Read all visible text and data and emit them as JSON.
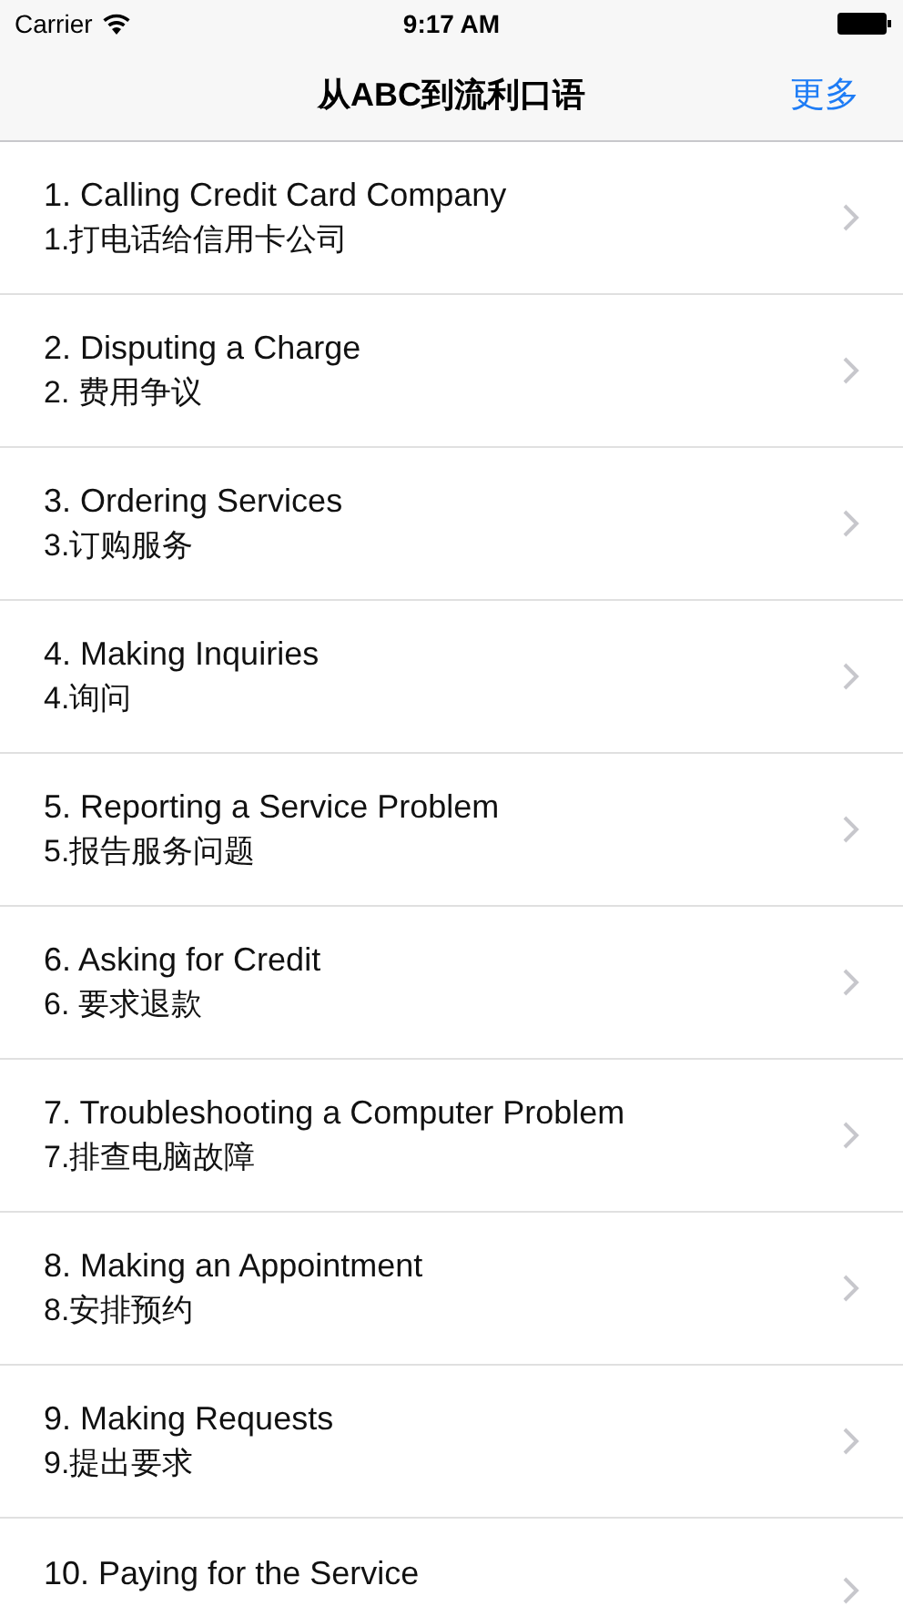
{
  "status_bar": {
    "carrier": "Carrier",
    "time": "9:17 AM"
  },
  "nav": {
    "title": "从ABC到流利口语",
    "action": "更多"
  },
  "items": [
    {
      "title": "1. Calling Credit Card Company",
      "subtitle": "1.打电话给信用卡公司"
    },
    {
      "title": "2. Disputing a Charge",
      "subtitle": "2. 费用争议"
    },
    {
      "title": "3. Ordering Services",
      "subtitle": "3.订购服务"
    },
    {
      "title": "4. Making Inquiries",
      "subtitle": "4.询问"
    },
    {
      "title": "5. Reporting a Service Problem",
      "subtitle": "5.报告服务问题"
    },
    {
      "title": "6. Asking for Credit",
      "subtitle": "6. 要求退款"
    },
    {
      "title": "7. Troubleshooting a Computer Problem",
      "subtitle": "7.排查电脑故障"
    },
    {
      "title": "8. Making an Appointment",
      "subtitle": "8.安排预约"
    },
    {
      "title": "9. Making Requests",
      "subtitle": "9.提出要求"
    },
    {
      "title": "10. Paying for the Service"
    }
  ]
}
